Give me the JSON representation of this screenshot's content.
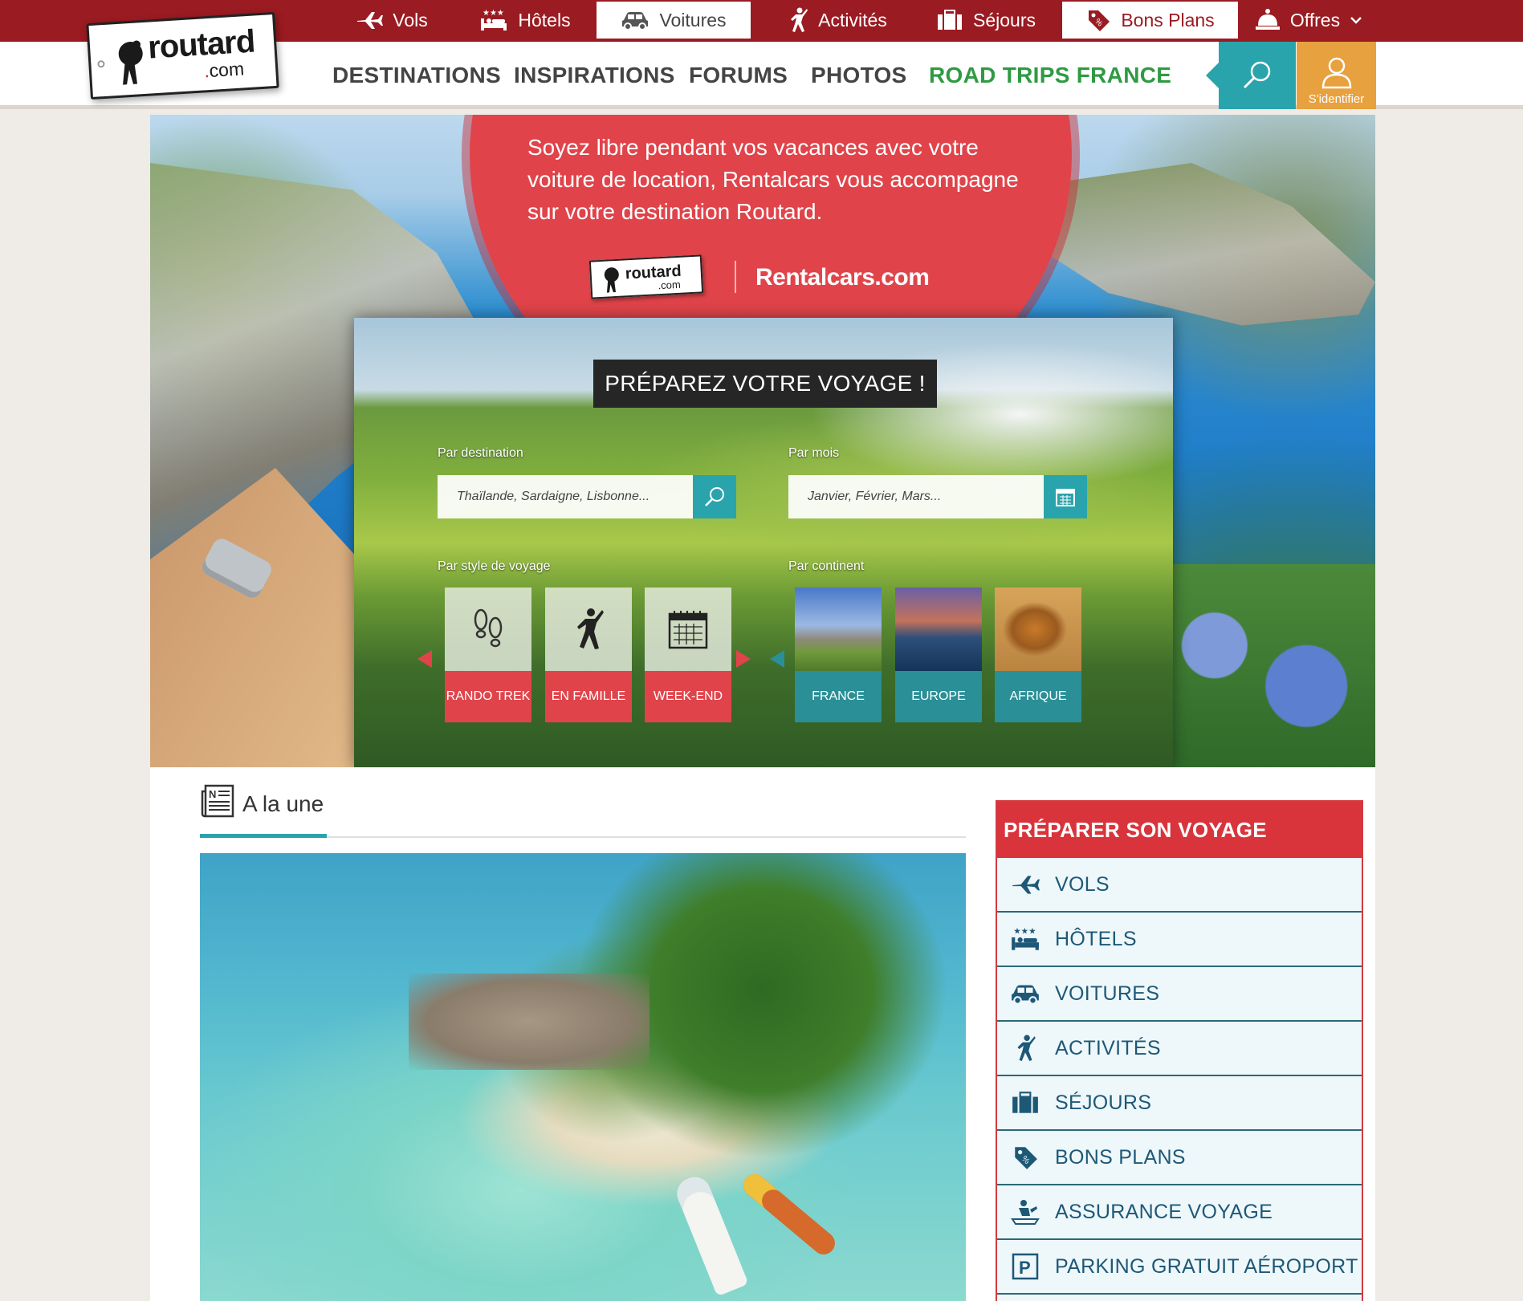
{
  "top_nav": [
    {
      "label": "Vols",
      "icon": "plane-icon"
    },
    {
      "label": "Hôtels",
      "icon": "hotel-icon"
    },
    {
      "label": "Voitures",
      "icon": "car-icon"
    },
    {
      "label": "Activités",
      "icon": "activity-icon"
    },
    {
      "label": "Séjours",
      "icon": "suitcase-icon"
    },
    {
      "label": "Bons Plans",
      "icon": "tag-icon"
    },
    {
      "label": "Offres",
      "icon": "bell-icon"
    }
  ],
  "logo": {
    "word": "routard",
    "dot": ".",
    "com": "com"
  },
  "main_nav": [
    "DESTINATIONS",
    "INSPIRATIONS",
    "FORUMS",
    "PHOTOS",
    "ROAD TRIPS FRANCE"
  ],
  "login_label": "S'identifier",
  "promo": {
    "text": "Soyez libre pendant vos vacances avec votre voiture de location, Rentalcars vous accompagne sur votre destination Routard.",
    "logo_word": "routard",
    "logo_com": ".com",
    "partner": "Rentalcars.com"
  },
  "planner": {
    "title": "PRÉPAREZ VOTRE VOYAGE !",
    "destination_label": "Par destination",
    "destination_placeholder": "Thaïlande, Sardaigne, Lisbonne...",
    "month_label": "Par mois",
    "month_placeholder": "Janvier, Février, Mars...",
    "style_label": "Par style de voyage",
    "continent_label": "Par continent",
    "styles": [
      "RANDO TREK",
      "EN FAMILLE",
      "WEEK-END"
    ],
    "continents": [
      "FRANCE",
      "EUROPE",
      "AFRIQUE"
    ]
  },
  "une": {
    "title": "A la une"
  },
  "sidebar": {
    "title": "PRÉPARER SON VOYAGE",
    "items": [
      "VOLS",
      "HÔTELS",
      "VOITURES",
      "ACTIVITÉS",
      "SÉJOURS",
      "BONS PLANS",
      "ASSURANCE VOYAGE",
      "PARKING GRATUIT AÉROPORT"
    ]
  },
  "colors": {
    "topbar": "#9a1b22",
    "accent_red": "#e0444a",
    "teal": "#2aa4ac",
    "orange": "#e8a13f",
    "green": "#2f9a43"
  }
}
